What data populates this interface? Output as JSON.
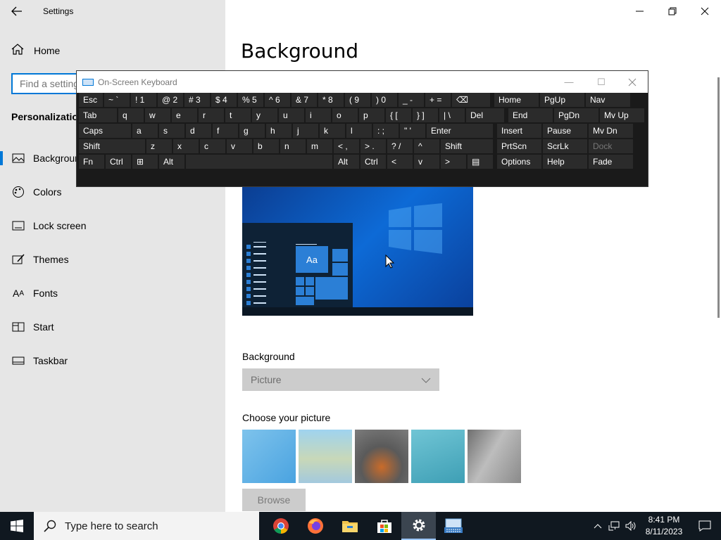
{
  "app": {
    "title": "Settings"
  },
  "nav": {
    "home": "Home",
    "search_placeholder": "Find a setting",
    "section": "Personalization",
    "items": [
      {
        "label": "Background",
        "icon": "picture-icon",
        "selected": true
      },
      {
        "label": "Colors",
        "icon": "palette-icon"
      },
      {
        "label": "Lock screen",
        "icon": "lock-screen-icon"
      },
      {
        "label": "Themes",
        "icon": "brush-icon"
      },
      {
        "label": "Fonts",
        "icon": "font-icon"
      },
      {
        "label": "Start",
        "icon": "start-icon"
      },
      {
        "label": "Taskbar",
        "icon": "taskbar-icon"
      }
    ]
  },
  "main": {
    "title": "Background",
    "preview_text": "Aa",
    "background_label": "Background",
    "background_value": "Picture",
    "choose_label": "Choose your picture",
    "browse_label": "Browse"
  },
  "osk": {
    "title": "On-Screen Keyboard",
    "rows": [
      [
        "Esc",
        "~ `",
        "! 1",
        "@ 2",
        "# 3",
        "$ 4",
        "% 5",
        "^ 6",
        "& 7",
        "* 8",
        "( 9",
        ") 0",
        "_ -",
        "+ =",
        "⌫",
        "Home",
        "PgUp",
        "Nav"
      ],
      [
        "Tab",
        "q",
        "w",
        "e",
        "r",
        "t",
        "y",
        "u",
        "i",
        "o",
        "p",
        "{ [",
        "} ]",
        "| \\",
        "Del",
        "End",
        "PgDn",
        "Mv Up"
      ],
      [
        "Caps",
        "a",
        "s",
        "d",
        "f",
        "g",
        "h",
        "j",
        "k",
        "l",
        ": ;",
        "\" '",
        "Enter",
        "Insert",
        "Pause",
        "Mv Dn"
      ],
      [
        "Shift",
        "z",
        "x",
        "c",
        "v",
        "b",
        "n",
        "m",
        "< ,",
        "> .",
        "? /",
        "^",
        "Shift",
        "PrtScn",
        "ScrLk",
        "Dock"
      ],
      [
        "Fn",
        "Ctrl",
        "⊞",
        "Alt",
        "",
        "Alt",
        "Ctrl",
        "<",
        "v",
        ">",
        "▤",
        "Options",
        "Help",
        "Fade"
      ]
    ]
  },
  "taskbar": {
    "search_placeholder": "Type here to search",
    "apps": [
      "chrome-icon",
      "firefox-icon",
      "file-explorer-icon",
      "store-icon",
      "settings-icon",
      "osk-icon"
    ],
    "time": "8:41 PM",
    "date": "8/11/2023"
  },
  "colors": {
    "accent": "#0078d7",
    "taskbar": "#101820",
    "osk_bg": "#1a1a1a"
  }
}
